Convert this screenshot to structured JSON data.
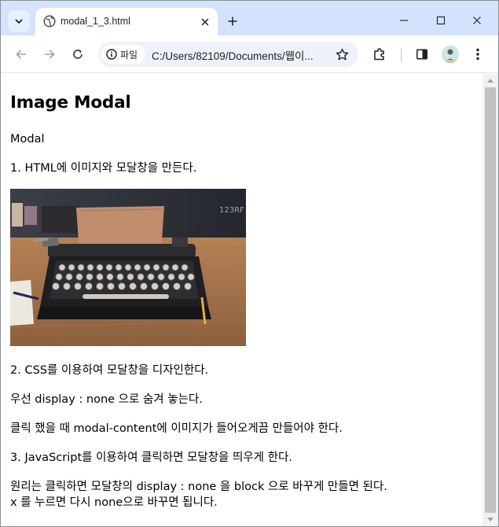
{
  "browser": {
    "tab_title": "modal_1_3.html",
    "chip_label": "파일",
    "url": "C:/Users/82109/Documents/웹이..."
  },
  "page": {
    "heading": "Image Modal",
    "modal_label": "Modal",
    "step1": "1. HTML에 이미지와 모달창을 만든다.",
    "step2": "2. CSS를 이용하여 모달창을 디자인한다.",
    "note1": "우선 display : none 으로 숨겨 놓는다.",
    "note2": "클릭 했을 때 modal-content에 이미지가 들어오게끔 만들어야 한다.",
    "step3": "3. JavaScript를 이용하여 클릭하면 모달창을 띄우게 한다.",
    "note3_line1": "원리는 클릭하면 모달창의 display : none 을 block 으로 바꾸게 만들면 된다.",
    "note3_line2": "x 를 누르면 다시 none으로 바꾸면 됩니다.",
    "image_watermark": "123RF"
  },
  "colors": {
    "tabstrip": "#d3e3fd",
    "omnibox": "#edf2fa",
    "scrollbar_thumb": "#c1c1c1"
  },
  "icons": [
    "chevron-down-icon",
    "globe-icon",
    "close-icon",
    "plus-icon",
    "minimize-icon",
    "maximize-icon",
    "window-close-icon",
    "back-arrow-icon",
    "forward-arrow-icon",
    "reload-icon",
    "info-icon",
    "star-icon",
    "extensions-icon",
    "sidepanel-icon",
    "kebab-menu-icon"
  ]
}
